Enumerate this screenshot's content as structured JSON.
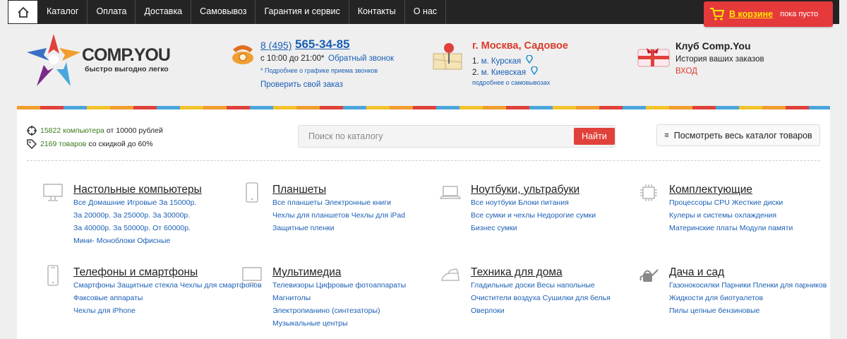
{
  "nav": [
    "Каталог",
    "Оплата",
    "Доставка",
    "Самовывоз",
    "Гарантия и сервис",
    "Контакты",
    "О нас"
  ],
  "cart": {
    "label": "В корзине",
    "status": "пока пусто"
  },
  "logo": {
    "brand": "COMP.YOU",
    "tagline": "быстро выгодно легко"
  },
  "phone": {
    "prefix": "8 (495)",
    "number": "565-34-85",
    "hours": "с 10:00 до 21:00*",
    "callback": "Обратный звонок",
    "note": "* Подробнее о графике приема звонков",
    "check_order": "Проверить свой заказ"
  },
  "location": {
    "city": "г. Москва, Садовое",
    "metro": [
      {
        "num": "1.",
        "name": "м. Курская"
      },
      {
        "num": "2.",
        "name": "м. Киевская"
      }
    ],
    "pickup": "подробнее о самовывозах"
  },
  "club": {
    "title": "Клуб Comp.You",
    "subtitle": "История ваших заказов",
    "login": "ВХОД"
  },
  "stats": [
    {
      "link": "15822 компьютера",
      "rest": "от 10000 рублей"
    },
    {
      "link": "2169 товаров",
      "rest": "со скидкой до 60%"
    }
  ],
  "search": {
    "placeholder": "Поиск по каталогу",
    "button": "Найти"
  },
  "catalog_button": "Посмотреть весь каталог товаров",
  "categories": [
    {
      "title": "Настольные компьютеры",
      "icon": "desktop-icon",
      "links": [
        "Все",
        "Домашние",
        "Игровые",
        "За 15000р.",
        "За 20000р.",
        "За 25000р.",
        "За 30000р.",
        "За 40000р.",
        "За 50000р.",
        "От 60000р.",
        "Мини-",
        "Моноблоки",
        "Офисные"
      ]
    },
    {
      "title": "Планшеты",
      "icon": "tablet-icon",
      "links": [
        "Все планшеты",
        "Электронные книги",
        "Чехлы для планшетов",
        "Чехлы для iPad",
        "Защитные пленки"
      ]
    },
    {
      "title": "Ноутбуки, ультрабуки",
      "icon": "laptop-icon",
      "links": [
        "Все ноутбуки",
        "Блоки питания",
        "Все сумки и чехлы",
        "Недорогие сумки",
        "Бизнес сумки"
      ]
    },
    {
      "title": "Комплектующие",
      "icon": "chip-icon",
      "links": [
        "Процессоры CPU",
        "Жесткие диски",
        "Кулеры и системы охлаждения",
        "Материнские платы",
        "Модули памяти"
      ]
    },
    {
      "title": "Телефоны и смартфоны",
      "icon": "phone-icon",
      "links": [
        "Смартфоны",
        "Защитные стекла",
        "Чехлы для смартфонов",
        "Факсовые аппараты",
        "Чехлы для iPhone"
      ]
    },
    {
      "title": "Мультимедиа",
      "icon": "monitor-icon",
      "links": [
        "Телевизоры",
        "Цифровые фотоаппараты",
        "Магнитолы",
        "Электропианино (синтезаторы)",
        "Музыкальные центры"
      ]
    },
    {
      "title": "Техника для дома",
      "icon": "iron-icon",
      "links": [
        "Гладильные доски",
        "Весы напольные",
        "Очистители воздуха",
        "Сушилки для белья",
        "Оверлоки"
      ]
    },
    {
      "title": "Дача и сад",
      "icon": "watering-can-icon",
      "links": [
        "Газонокосилки",
        "Парники",
        "Пленки для парников",
        "Жидкости для биотуалетов",
        "Пилы цепные бензиновые"
      ]
    }
  ]
}
